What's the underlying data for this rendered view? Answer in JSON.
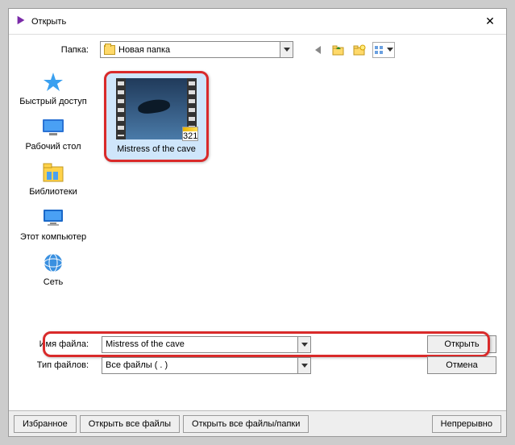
{
  "window": {
    "title": "Открыть"
  },
  "folder": {
    "label": "Папка:",
    "value": "Новая папка"
  },
  "places": [
    {
      "key": "quick",
      "label": "Быстрый доступ"
    },
    {
      "key": "desktop",
      "label": "Рабочий стол"
    },
    {
      "key": "libs",
      "label": "Библиотеки"
    },
    {
      "key": "pc",
      "label": "Этот компьютер"
    },
    {
      "key": "net",
      "label": "Сеть"
    }
  ],
  "file": {
    "name": "Mistress of the cave",
    "badge": "321"
  },
  "fields": {
    "name_label": "Имя файла:",
    "name_value": "Mistress of the cave",
    "type_label": "Тип файлов:",
    "type_value": "Все файлы ( . )",
    "open": "Открыть",
    "cancel": "Отмена"
  },
  "bottom": {
    "fav": "Избранное",
    "open_all": "Открыть все файлы",
    "open_all_folders": "Открыть все файлы/папки",
    "continuous": "Непрерывно"
  }
}
